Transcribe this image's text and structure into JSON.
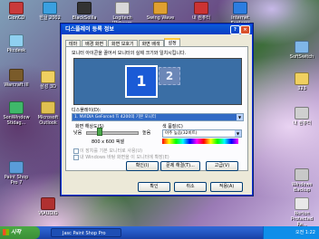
{
  "desktop": {
    "icons": [
      {
        "label": "ClonCD"
      },
      {
        "label": "한글 2002"
      },
      {
        "label": "BlackSollla"
      },
      {
        "label": "Logitech Webcam"
      },
      {
        "label": "Swing Wave"
      },
      {
        "label": "Internet Explorer"
      },
      {
        "label": "Pkcdesk"
      },
      {
        "label": "Warcraft III"
      },
      {
        "label": "Microsoft Outlook"
      },
      {
        "label": "SonWindow Stidag..."
      },
      {
        "label": "Paint Shop Pro 7"
      },
      {
        "label": "VIAUDIO"
      },
      {
        "label": "SoftSwitch"
      },
      {
        "label": "Windows Backup"
      },
      {
        "label": "Norton Protected Re..."
      },
      {
        "label": "삼성 3D"
      },
      {
        "label": "323"
      },
      {
        "label": "내 컴퓨터"
      }
    ]
  },
  "dialog": {
    "title": "디스플레이 등록 정보",
    "close_glyph": "×",
    "help_glyph": "?",
    "tabs": [
      "테마",
      "배경 화면",
      "화면 보호기",
      "화면 배색",
      "설정"
    ],
    "active_tab": "설정",
    "description": "모니터 아이콘을 끌어서 모니터의 실제 크기와 일치시킵니다.",
    "monitor1": "1",
    "monitor2": "2",
    "display_label": "디스플레이(D):",
    "display_value": "1. NVIDIA GeForce4 Ti 4200의 기본 모니터",
    "resolution_label": "화면 해상도(S)",
    "res_low": "낮음",
    "res_high": "높음",
    "resolution_value": "800 x 600 픽셀",
    "color_label": "색 품질(C)",
    "color_value": "아주 높음(32비트)",
    "checkbox1": "이 장치를 기본 모니터로 사용(U)",
    "checkbox2": "내 Windows 바탕 화면을 이 모니터에 확장(E)",
    "identify_button": "확인(I)",
    "troubleshoot_button": "문제 해결(T)...",
    "advanced_button": "고급(V)",
    "ok_button": "확인",
    "cancel_button": "취소",
    "apply_button": "적용(A)"
  },
  "taskbar": {
    "start_label": "시작",
    "task_label": "Jasc Paint Shop Pro",
    "clock": "오전 1:22"
  }
}
